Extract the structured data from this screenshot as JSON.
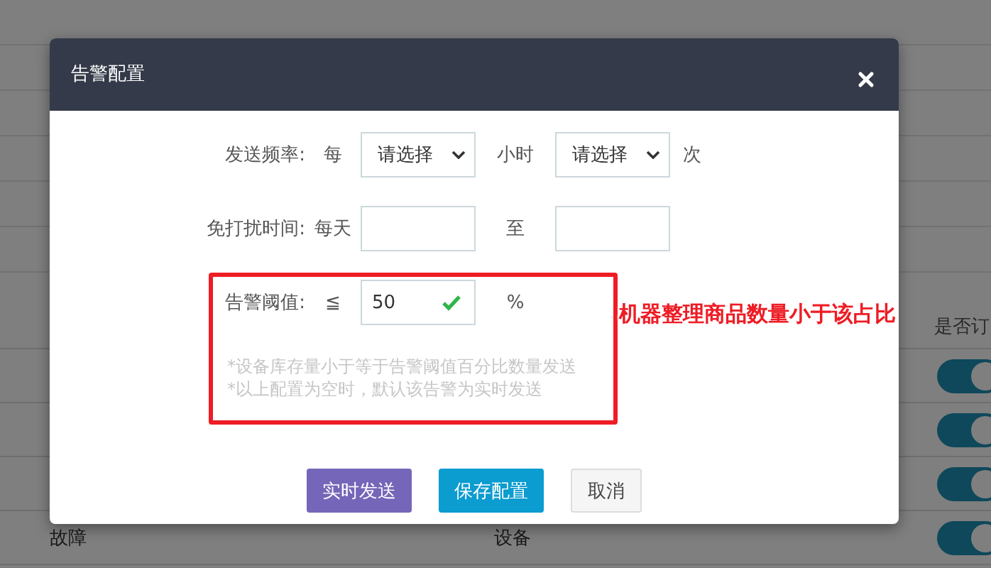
{
  "background_table": {
    "column_header": "是否订",
    "rows": [
      {
        "cells": [],
        "on": true
      },
      {
        "cells": [],
        "on": true
      },
      {
        "cells": [],
        "on": true
      },
      {
        "cells": [
          "故障",
          "设备"
        ],
        "on": true
      }
    ]
  },
  "dialog": {
    "title": "告警配置",
    "frequency": {
      "label": "发送频率:",
      "prefix": "每",
      "select_1": "请选择",
      "unit": "小时",
      "select_2": "请选择",
      "suffix": "次"
    },
    "quiet_time": {
      "label": "免打扰时间:",
      "prefix": "每天",
      "separator": "至"
    },
    "threshold": {
      "label": "告警阈值:",
      "operator": "≦",
      "value": "50",
      "valid": true,
      "unit": "%"
    },
    "notes": [
      "*设备库存量小于等于告警阈值百分比数量发送",
      "*以上配置为空时，默认该告警为实时发送"
    ],
    "buttons": [
      {
        "label": "实时发送",
        "kind": "purple"
      },
      {
        "label": "保存配置",
        "kind": "primary"
      },
      {
        "label": "取消",
        "kind": "plain"
      }
    ]
  },
  "annotation": {
    "text": "机器整理商品数量小于该占比"
  }
}
